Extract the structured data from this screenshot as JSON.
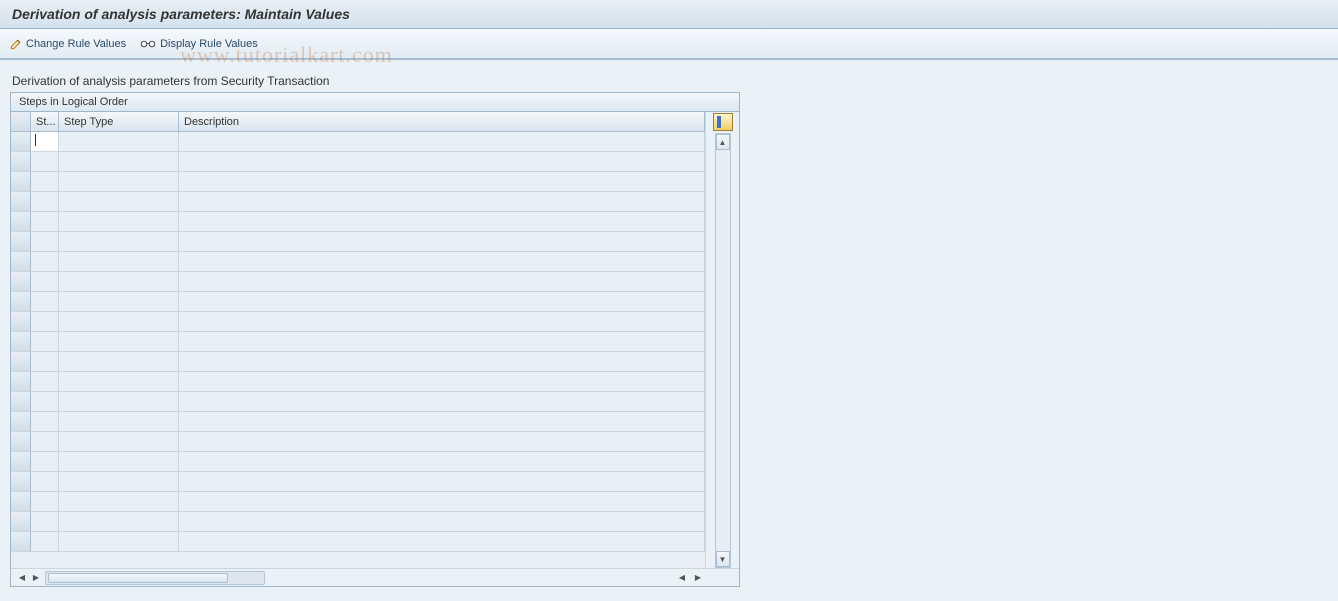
{
  "title": "Derivation of analysis parameters: Maintain Values",
  "toolbar": {
    "change_label": "Change Rule Values",
    "display_label": "Display Rule Values"
  },
  "subtitle": "Derivation of analysis parameters from Security Transaction",
  "panel_header": "Steps in Logical Order",
  "columns": {
    "st": "St...",
    "step_type": "Step Type",
    "description": "Description"
  },
  "rows": [
    {
      "st": "",
      "step_type": "",
      "description": ""
    },
    {
      "st": "",
      "step_type": "",
      "description": ""
    },
    {
      "st": "",
      "step_type": "",
      "description": ""
    },
    {
      "st": "",
      "step_type": "",
      "description": ""
    },
    {
      "st": "",
      "step_type": "",
      "description": ""
    },
    {
      "st": "",
      "step_type": "",
      "description": ""
    },
    {
      "st": "",
      "step_type": "",
      "description": ""
    },
    {
      "st": "",
      "step_type": "",
      "description": ""
    },
    {
      "st": "",
      "step_type": "",
      "description": ""
    },
    {
      "st": "",
      "step_type": "",
      "description": ""
    },
    {
      "st": "",
      "step_type": "",
      "description": ""
    },
    {
      "st": "",
      "step_type": "",
      "description": ""
    },
    {
      "st": "",
      "step_type": "",
      "description": ""
    },
    {
      "st": "",
      "step_type": "",
      "description": ""
    },
    {
      "st": "",
      "step_type": "",
      "description": ""
    },
    {
      "st": "",
      "step_type": "",
      "description": ""
    },
    {
      "st": "",
      "step_type": "",
      "description": ""
    },
    {
      "st": "",
      "step_type": "",
      "description": ""
    },
    {
      "st": "",
      "step_type": "",
      "description": ""
    },
    {
      "st": "",
      "step_type": "",
      "description": ""
    },
    {
      "st": "",
      "step_type": "",
      "description": ""
    }
  ],
  "watermark": "www.tutorialkart.com"
}
